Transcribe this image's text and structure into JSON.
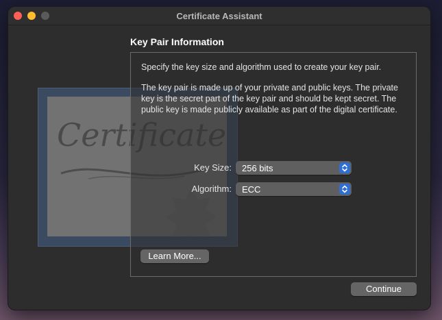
{
  "window": {
    "title": "Certificate Assistant"
  },
  "section": {
    "heading": "Key Pair Information"
  },
  "content": {
    "paragraph1": "Specify the key size and algorithm used to create your key pair.",
    "paragraph2": "The key pair is made up of your private and public keys. The private key is the secret part of the key pair and should be kept secret. The public key is made publicly available as part of the digital certificate."
  },
  "form": {
    "key_size": {
      "label": "Key Size:",
      "value": "256 bits",
      "icon": "chevron-up-down-icon"
    },
    "algorithm": {
      "label": "Algorithm:",
      "value": "ECC",
      "icon": "chevron-up-down-icon"
    }
  },
  "buttons": {
    "learn_more": "Learn More...",
    "continue": "Continue"
  },
  "illustration": {
    "cert_text": "Certificate"
  },
  "colors": {
    "accent": "#2e6fd6",
    "close": "#fe5f57",
    "minimize": "#febc2e",
    "zoom_disabled": "#5a5a5a",
    "window_bg": "#2d2d2d"
  }
}
